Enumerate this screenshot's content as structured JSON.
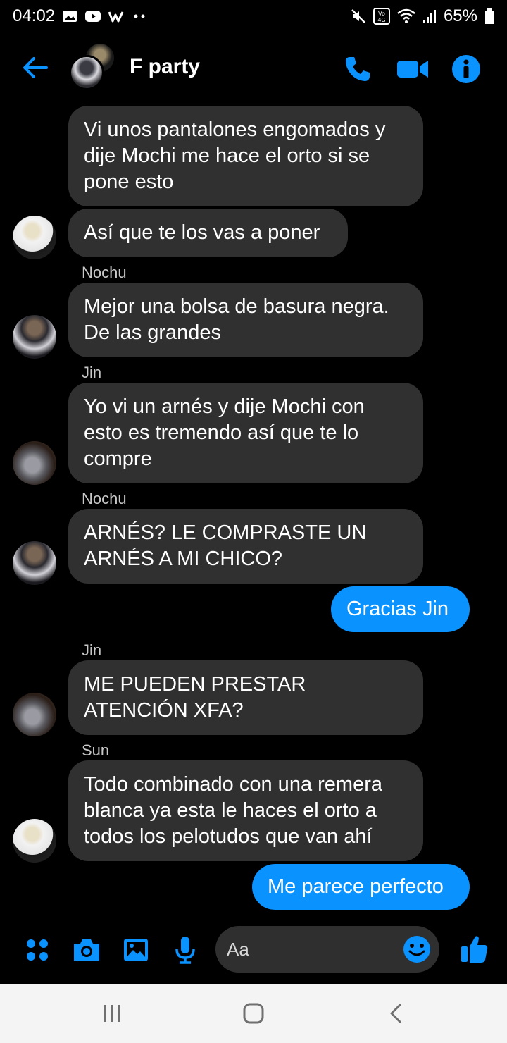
{
  "status_bar": {
    "time": "04:02",
    "battery": "65%",
    "left_icons": [
      "gallery-icon",
      "youtube-icon",
      "w-app-icon",
      "more-dots-icon"
    ],
    "right_icons": [
      "mute-icon",
      "volte-4g-icon",
      "wifi-icon",
      "signal-icon",
      "battery-icon"
    ],
    "volte_label": "Vo 4G"
  },
  "header": {
    "title": "F party",
    "icons": [
      "back-arrow-icon",
      "phone-icon",
      "video-icon",
      "info-icon"
    ],
    "accent": "#0a92ff"
  },
  "messages": [
    {
      "type": "received",
      "sender": "",
      "text": "Vi unos pantalones engomados y\ndije Mochi me hace el orto si se\npone esto",
      "avatar": ""
    },
    {
      "type": "received",
      "sender": "",
      "text": "Así que te los vas a poner",
      "avatar": "Sun"
    },
    {
      "type": "received",
      "sender": "Nochu",
      "text": "Mejor una bolsa de basura negra.\nDe las grandes",
      "avatar": "Nochu"
    },
    {
      "type": "received",
      "sender": "Jin",
      "text": "Yo vi un arnés y dije Mochi con\nesto es tremendo así que te lo\ncompre",
      "avatar": "Jin"
    },
    {
      "type": "received",
      "sender": "Nochu",
      "text": "ARNÉS? LE COMPRASTE UN\nARNÉS A MI CHICO?",
      "avatar": "Nochu"
    },
    {
      "type": "sent",
      "text": "Gracias Jin"
    },
    {
      "type": "received",
      "sender": "Jin",
      "text": "ME PUEDEN PRESTAR\nATENCIÓN XFA?",
      "avatar": "Jin"
    },
    {
      "type": "received",
      "sender": "Sun",
      "text": "Todo combinado con una remera\nblanca ya esta le haces el orto a\ntodos los pelotudos que van ahí",
      "avatar": "Sun"
    },
    {
      "type": "sent",
      "text": "Me parece perfecto"
    }
  ],
  "composer": {
    "placeholder": "Aa",
    "icons": [
      "apps-grid-icon",
      "camera-icon",
      "image-icon",
      "mic-icon",
      "emoji-icon",
      "thumbs-up-icon"
    ]
  },
  "navbar": {
    "icons": [
      "recents-icon",
      "home-icon",
      "back-icon"
    ],
    "background": "#f4f4f4"
  },
  "colors": {
    "background": "#000000",
    "received_bubble": "#303030",
    "sent_bubble": "#0a92ff",
    "accent": "#0a92ff"
  }
}
